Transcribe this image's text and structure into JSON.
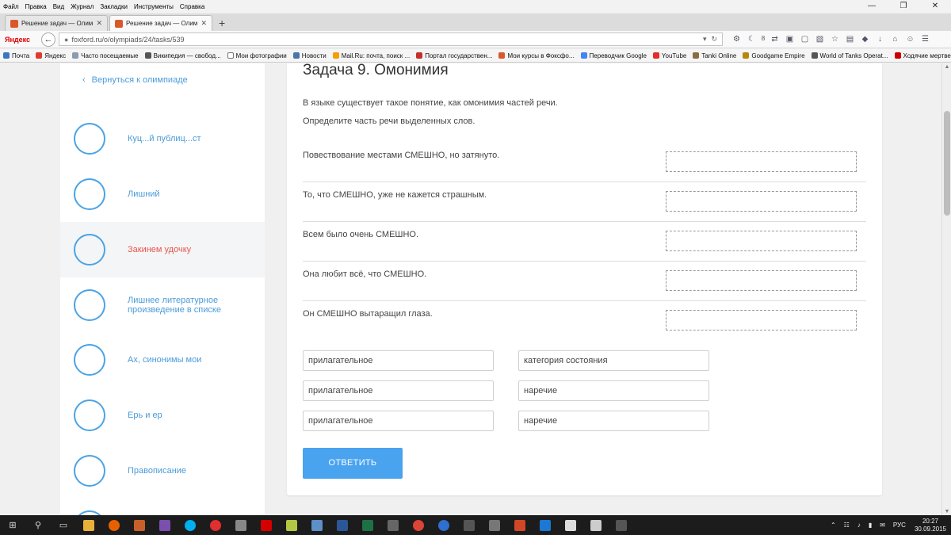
{
  "menubar": {
    "items": [
      "Файл",
      "Правка",
      "Вид",
      "Журнал",
      "Закладки",
      "Инструменты",
      "Справка"
    ]
  },
  "tabs": [
    {
      "label": "Решение задач — Олим...",
      "active": false
    },
    {
      "label": "Решение задач — Олим...",
      "active": true
    }
  ],
  "navbar": {
    "brand": "Яндекс",
    "url": "foxford.ru/o/olympiads/24/tasks/539",
    "counter": "8"
  },
  "bookmarks": [
    "Почта",
    "Яндекс",
    "Часто посещаемые",
    "Википедия — свобод...",
    "Мои фотографии",
    "Новости",
    "Mail.Ru: почта, поиск ...",
    "Портал государствен...",
    "Мои курсы в Фоксфо...",
    "Переводчик Google",
    "YouTube",
    "Tanki Online",
    "Goodgame Empire",
    "World of Tanks Operat...",
    "Ходячие мертвецы (5 ..."
  ],
  "sidebar": {
    "back_label": "Вернуться к олимпиаде",
    "lessons": [
      {
        "label": "Куц...й публиц...ст",
        "active": false
      },
      {
        "label": "Лишний",
        "active": false
      },
      {
        "label": "Закинем удочку",
        "active": true
      },
      {
        "label": "Лишнее литературное произведение в списке",
        "active": false
      },
      {
        "label": "Ах, синонимы мои",
        "active": false
      },
      {
        "label": "Ерь и ер",
        "active": false
      },
      {
        "label": "Правописание",
        "active": false
      }
    ]
  },
  "task": {
    "title": "Задача 9. Омонимия",
    "intro": "В языке существует такое понятие, как омонимия частей речи.",
    "instruction": "Определите часть речи выделенных слов.",
    "sentences": [
      "Повествование местами СМЕШНО, но затянуто.",
      "То, что СМЕШНО, уже не кажется страшным.",
      "Всем было очень СМЕШНО.",
      "Она любит всё, что СМЕШНО.",
      "Он СМЕШНО вытаращил глаза."
    ],
    "options": [
      "прилагательное",
      "категория состояния",
      "прилагательное",
      "наречие",
      "прилагательное",
      "наречие"
    ],
    "submit_label": "ОТВЕТИТЬ"
  },
  "taskbar": {
    "lang": "РУС",
    "time": "20:27",
    "date": "30.09.2015"
  },
  "colors": {
    "accent": "#4aa3ee",
    "active_lesson": "#e8564a",
    "link": "#4a9bd9"
  }
}
